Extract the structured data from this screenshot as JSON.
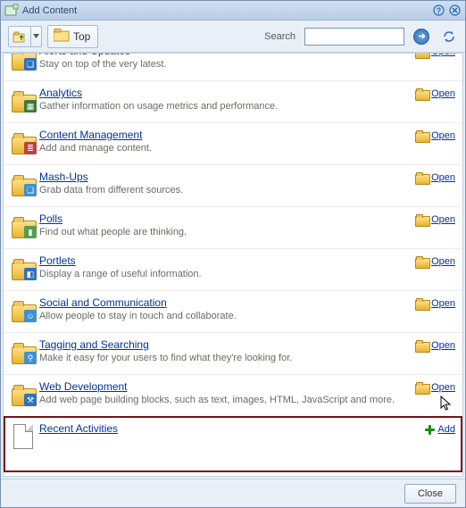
{
  "dialog": {
    "title": "Add Content"
  },
  "toolbar": {
    "top_label": "Top"
  },
  "search": {
    "label": "Search",
    "value": "",
    "placeholder": ""
  },
  "actions": {
    "open": "Open",
    "add": "Add",
    "close": "Close"
  },
  "rows": [
    {
      "title": "Alerts and Updates",
      "desc": "Stay on top of the very latest.",
      "action": "open",
      "partial": true,
      "badge_bg": "#3070c0",
      "badge_glyph": "❑"
    },
    {
      "title": "Analytics",
      "desc": "Gather information on usage metrics and performance.",
      "action": "open",
      "badge_bg": "#3a7a3a",
      "badge_glyph": "▦"
    },
    {
      "title": "Content Management",
      "desc": "Add and manage content.",
      "action": "open",
      "badge_bg": "#c04040",
      "badge_glyph": "≣"
    },
    {
      "title": "Mash-Ups",
      "desc": "Grab data from different sources.",
      "action": "open",
      "badge_bg": "#4090d0",
      "badge_glyph": "❏"
    },
    {
      "title": "Polls",
      "desc": "Find out what people are thinking.",
      "action": "open",
      "badge_bg": "#50a050",
      "badge_glyph": "▮"
    },
    {
      "title": "Portlets",
      "desc": "Display a range of useful information.",
      "action": "open",
      "badge_bg": "#3070c0",
      "badge_glyph": "◧"
    },
    {
      "title": "Social and Communication",
      "desc": "Allow people to stay in touch and collaborate.",
      "action": "open",
      "badge_bg": "#4090d0",
      "badge_glyph": "☺"
    },
    {
      "title": "Tagging and Searching",
      "desc": "Make it easy for your users to find what they're looking for.",
      "action": "open",
      "badge_bg": "#4090d0",
      "badge_glyph": "⚲"
    },
    {
      "title": "Web Development",
      "desc": "Add web page building blocks, such as text, images, HTML, JavaScript and more.",
      "action": "open",
      "badge_bg": "#3070c0",
      "badge_glyph": "⚒"
    },
    {
      "title": "Recent Activities",
      "desc": "",
      "action": "add",
      "doc": true,
      "highlight": true
    }
  ]
}
